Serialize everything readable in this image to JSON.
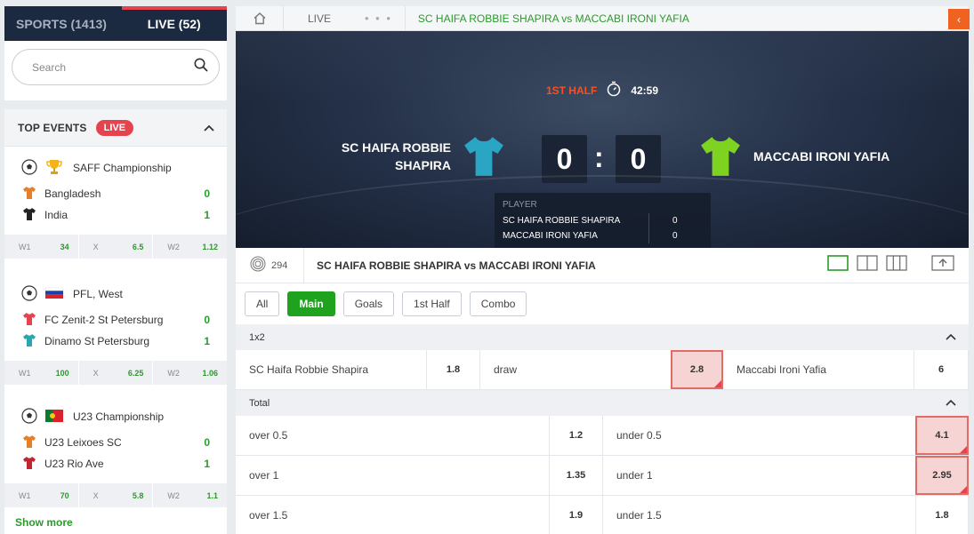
{
  "sidebar": {
    "tab_sports": "SPORTS (1413)",
    "tab_live": "LIVE (52)",
    "search_placeholder": "Search",
    "top_events_title": "TOP EVENTS",
    "live_badge": "LIVE",
    "show_more": "Show more",
    "events": [
      {
        "league": "SAFF Championship",
        "league_icon": "trophy-icon",
        "home": "Bangladesh",
        "home_score": "0",
        "home_shirt": "#e57f2a",
        "away": "India",
        "away_score": "1",
        "away_shirt": "#222222",
        "w1_label": "W1",
        "w1": "34",
        "x_label": "X",
        "x": "6.5",
        "w2_label": "W2",
        "w2": "1.12"
      },
      {
        "league": "PFL, West",
        "league_icon": "russia-flag-icon",
        "home": "FC Zenit-2 St Petersburg",
        "home_score": "0",
        "home_shirt": "#e5434e",
        "away": "Dinamo St Petersburg",
        "away_score": "1",
        "away_shirt": "#2aa6b0",
        "w1_label": "W1",
        "w1": "100",
        "x_label": "X",
        "x": "6.25",
        "w2_label": "W2",
        "w2": "1.06"
      },
      {
        "league": "U23 Championship",
        "league_icon": "portugal-flag-icon",
        "home": "U23 Leixoes SC",
        "home_score": "0",
        "home_shirt": "#e57f2a",
        "away": "U23 Rio Ave",
        "away_score": "1",
        "away_shirt": "#c0262f",
        "w1_label": "W1",
        "w1": "70",
        "x_label": "X",
        "x": "5.8",
        "w2_label": "W2",
        "w2": "1.1"
      }
    ]
  },
  "breadcrumb": {
    "live": "LIVE",
    "dots": "• • •",
    "match": "SC HAIFA ROBBIE SHAPIRA vs MACCABI IRONI YAFIA"
  },
  "scoreboard": {
    "period": "1ST HALF",
    "time": "42:59",
    "home_line1": "SC HAIFA ROBBIE",
    "home_line2": "SHAPIRA",
    "away": "MACCABI IRONI YAFIA",
    "home_score": "0",
    "away_score": "0",
    "colon": ":",
    "home_shirt": "#2aa6c4",
    "away_shirt": "#7ed321",
    "player_header": "PLAYER",
    "player_rows": [
      {
        "name": "SC HAIFA ROBBIE SHAPIRA",
        "value": "0"
      },
      {
        "name": "MACCABI IRONI YAFIA",
        "value": "0"
      }
    ]
  },
  "match_bar": {
    "count": "294",
    "title": "SC HAIFA ROBBIE SHAPIRA vs MACCABI IRONI YAFIA"
  },
  "filters": [
    "All",
    "Main",
    "Goals",
    "1st Half",
    "Combo"
  ],
  "active_filter": "Main",
  "markets": {
    "m1x2": {
      "title": "1x2",
      "home": "SC Haifa Robbie Shapira",
      "home_odd": "1.8",
      "draw": "draw",
      "draw_odd": "2.8",
      "away": "Maccabi Ironi Yafia",
      "away_odd": "6"
    },
    "total": {
      "title": "Total",
      "rows": [
        {
          "over": "over 0.5",
          "over_odd": "1.2",
          "under": "under 0.5",
          "under_odd": "4.1"
        },
        {
          "over": "over 1",
          "over_odd": "1.35",
          "under": "under 1",
          "under_odd": "2.95"
        },
        {
          "over": "over 1.5",
          "over_odd": "1.9",
          "under": "under 1.5",
          "under_odd": "1.8"
        }
      ]
    }
  },
  "colors": {
    "accent_green": "#2b9a2b",
    "live_red": "#e5434e",
    "nav_dark": "#1b2a41",
    "highlight_odd": "#f6d4d3",
    "back_orange": "#f0621f"
  }
}
